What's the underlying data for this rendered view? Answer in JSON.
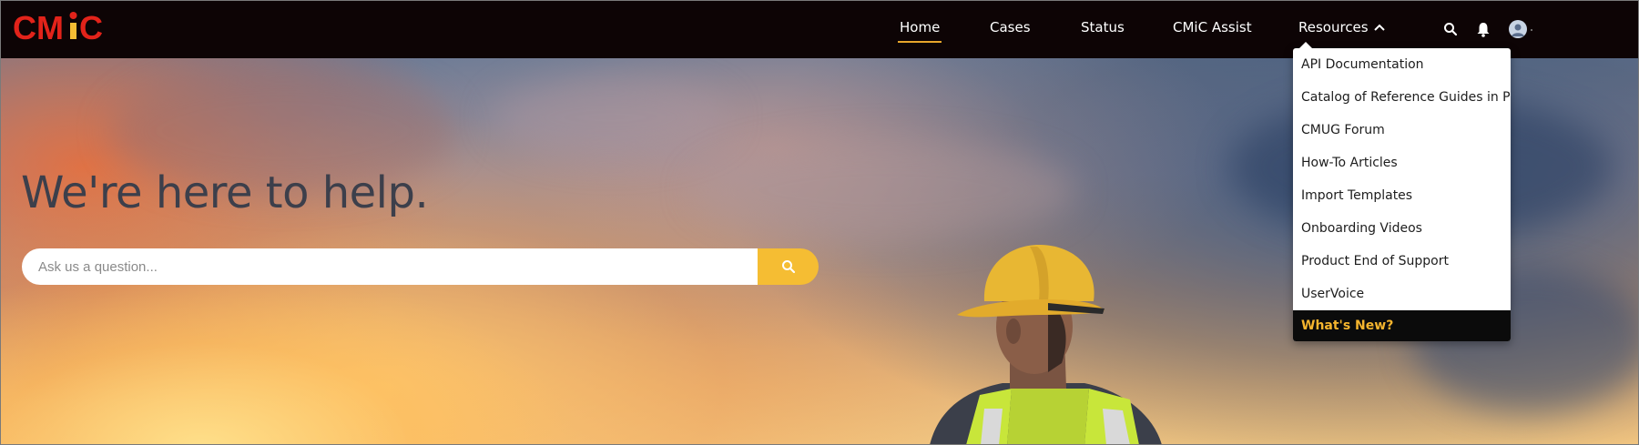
{
  "brand": {
    "logo_text": "CMiC",
    "logo_color": "#e2231a",
    "logo_accent": "#f5bd33"
  },
  "nav": {
    "items": [
      {
        "label": "Home",
        "active": true
      },
      {
        "label": "Cases",
        "active": false
      },
      {
        "label": "Status",
        "active": false
      },
      {
        "label": "CMiC Assist",
        "active": false
      },
      {
        "label": "Resources",
        "active": false,
        "expanded": true
      }
    ],
    "icons": [
      "search-icon",
      "bell-icon",
      "user-avatar-icon"
    ]
  },
  "resources_menu": {
    "items": [
      {
        "label": "API Documentation"
      },
      {
        "label": "Catalog of Reference Guides in PDF"
      },
      {
        "label": "CMUG Forum"
      },
      {
        "label": "How-To Articles"
      },
      {
        "label": "Import Templates"
      },
      {
        "label": "Onboarding Videos"
      },
      {
        "label": "Product End of Support"
      },
      {
        "label": "UserVoice"
      },
      {
        "label": "What's New?",
        "highlighted": true
      }
    ]
  },
  "hero": {
    "title": "We're here to help.",
    "search": {
      "placeholder": "Ask us a question...",
      "value": ""
    }
  },
  "colors": {
    "navbar_bg": "#0d0405",
    "active_underline": "#e7a52b",
    "search_button": "#f5bd33",
    "highlight_text": "#f5b52e"
  }
}
